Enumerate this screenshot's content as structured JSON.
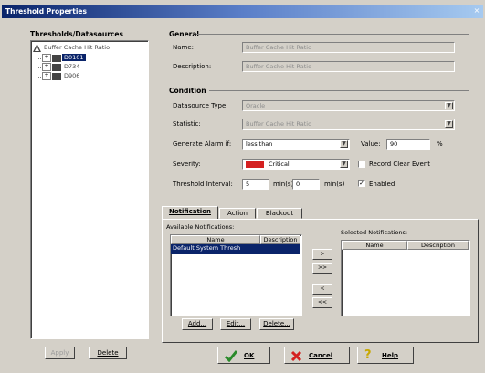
{
  "window": {
    "title": "Threshold Properties",
    "close_glyph": "×"
  },
  "tree": {
    "header": "Thresholds/Datasources",
    "root_label": "Buffer Cache Hit Ratio",
    "items": [
      {
        "label": "D0101",
        "selected": true
      },
      {
        "label": "D734",
        "selected": false
      },
      {
        "label": "D906",
        "selected": false
      }
    ],
    "apply_label": "Apply",
    "delete_label": "Delete"
  },
  "general": {
    "heading": "General",
    "name_label": "Name:",
    "name_value": "Buffer Cache Hit Ratio",
    "description_label": "Description:",
    "description_value": "Buffer Cache Hit Ratio"
  },
  "condition": {
    "heading": "Condition",
    "datasource_type_label": "Datasource Type:",
    "datasource_type_value": "Oracle",
    "statistic_label": "Statistic:",
    "statistic_value": "Buffer Cache Hit Ratio",
    "generate_alarm_label": "Generate Alarm if:",
    "generate_alarm_value": "less than",
    "value_label": "Value:",
    "value_value": "90",
    "value_unit": "%",
    "severity_label": "Severity:",
    "severity_value": "Critical",
    "severity_color": "#d42020",
    "record_clear_label": "Record Clear Event",
    "record_clear_checked": false,
    "interval_label": "Threshold Interval:",
    "interval_value1": "5",
    "interval_unit1": "min(s)",
    "interval_value2": "0",
    "interval_unit2": "min(s)",
    "enabled_label": "Enabled",
    "enabled_checked": true
  },
  "tabs": [
    {
      "label": "Notification",
      "active": true
    },
    {
      "label": "Action",
      "active": false
    },
    {
      "label": "Blackout",
      "active": false
    }
  ],
  "notification": {
    "available_label": "Available Notifications:",
    "selected_label": "Selected Notifications:",
    "col_name": "Name",
    "col_description": "Description",
    "available_rows": [
      {
        "name": "Default System Thresh",
        "description": ""
      }
    ],
    "move_buttons": [
      ">",
      ">>",
      "<",
      "<<"
    ],
    "add_label": "Add...",
    "edit_label": "Edit...",
    "delete_label": "Delete..."
  },
  "footer": {
    "ok_label": "OK",
    "cancel_label": "Cancel",
    "help_label": "Help"
  },
  "icons": {
    "ok": "check-icon",
    "cancel": "x-icon",
    "help": "question-icon",
    "folder": "folder-icon"
  }
}
